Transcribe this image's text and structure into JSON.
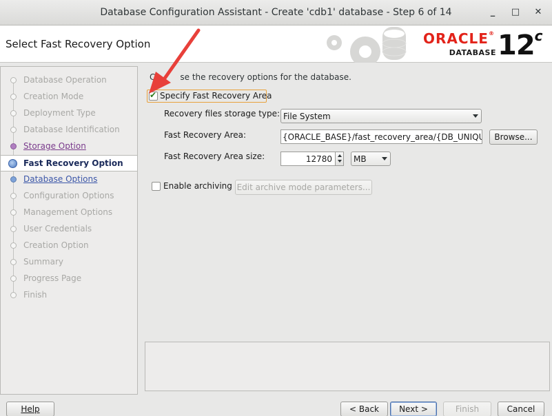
{
  "window": {
    "title": "Database Configuration Assistant - Create 'cdb1' database - Step 6 of 14",
    "minimize_glyph": "_",
    "maximize_glyph": "□",
    "close_glyph": "✕"
  },
  "header": {
    "page_title": "Select Fast Recovery Option",
    "logo_word": "ORACLE",
    "logo_registered": "®",
    "logo_sub": "DATABASE",
    "version_main": "12",
    "version_sup": "c"
  },
  "nav": {
    "items": [
      {
        "label": "Database Operation",
        "state": "disabled"
      },
      {
        "label": "Creation Mode",
        "state": "disabled"
      },
      {
        "label": "Deployment Type",
        "state": "disabled"
      },
      {
        "label": "Database Identification",
        "state": "disabled"
      },
      {
        "label": "Storage Option",
        "state": "visited"
      },
      {
        "label": "Fast Recovery Option",
        "state": "current"
      },
      {
        "label": "Database Options",
        "state": "link"
      },
      {
        "label": "Configuration Options",
        "state": "disabled"
      },
      {
        "label": "Management Options",
        "state": "disabled"
      },
      {
        "label": "User Credentials",
        "state": "disabled"
      },
      {
        "label": "Creation Option",
        "state": "disabled"
      },
      {
        "label": "Summary",
        "state": "disabled"
      },
      {
        "label": "Progress Page",
        "state": "disabled"
      },
      {
        "label": "Finish",
        "state": "disabled"
      }
    ]
  },
  "form": {
    "intro_pre": "C",
    "intro_post": "se the recovery options for the database.",
    "specify_fra": {
      "label": "Specify Fast Recovery Area",
      "checked": true
    },
    "storage_type": {
      "label": "Recovery files storage type:",
      "value": "File System"
    },
    "fra_path": {
      "label": "Fast Recovery Area:",
      "value": "{ORACLE_BASE}/fast_recovery_area/{DB_UNIQUE_",
      "browse": "Browse..."
    },
    "fra_size": {
      "label": "Fast Recovery Area size:",
      "value": "12780",
      "unit": "MB"
    },
    "archiving": {
      "label": "Enable archiving",
      "checked": false,
      "edit_button": "Edit archive mode parameters..."
    }
  },
  "footer": {
    "help": "Help",
    "back": "< Back",
    "next": "Next >",
    "finish": "Finish",
    "cancel": "Cancel"
  },
  "annotation": {
    "color": "#e8403a"
  }
}
